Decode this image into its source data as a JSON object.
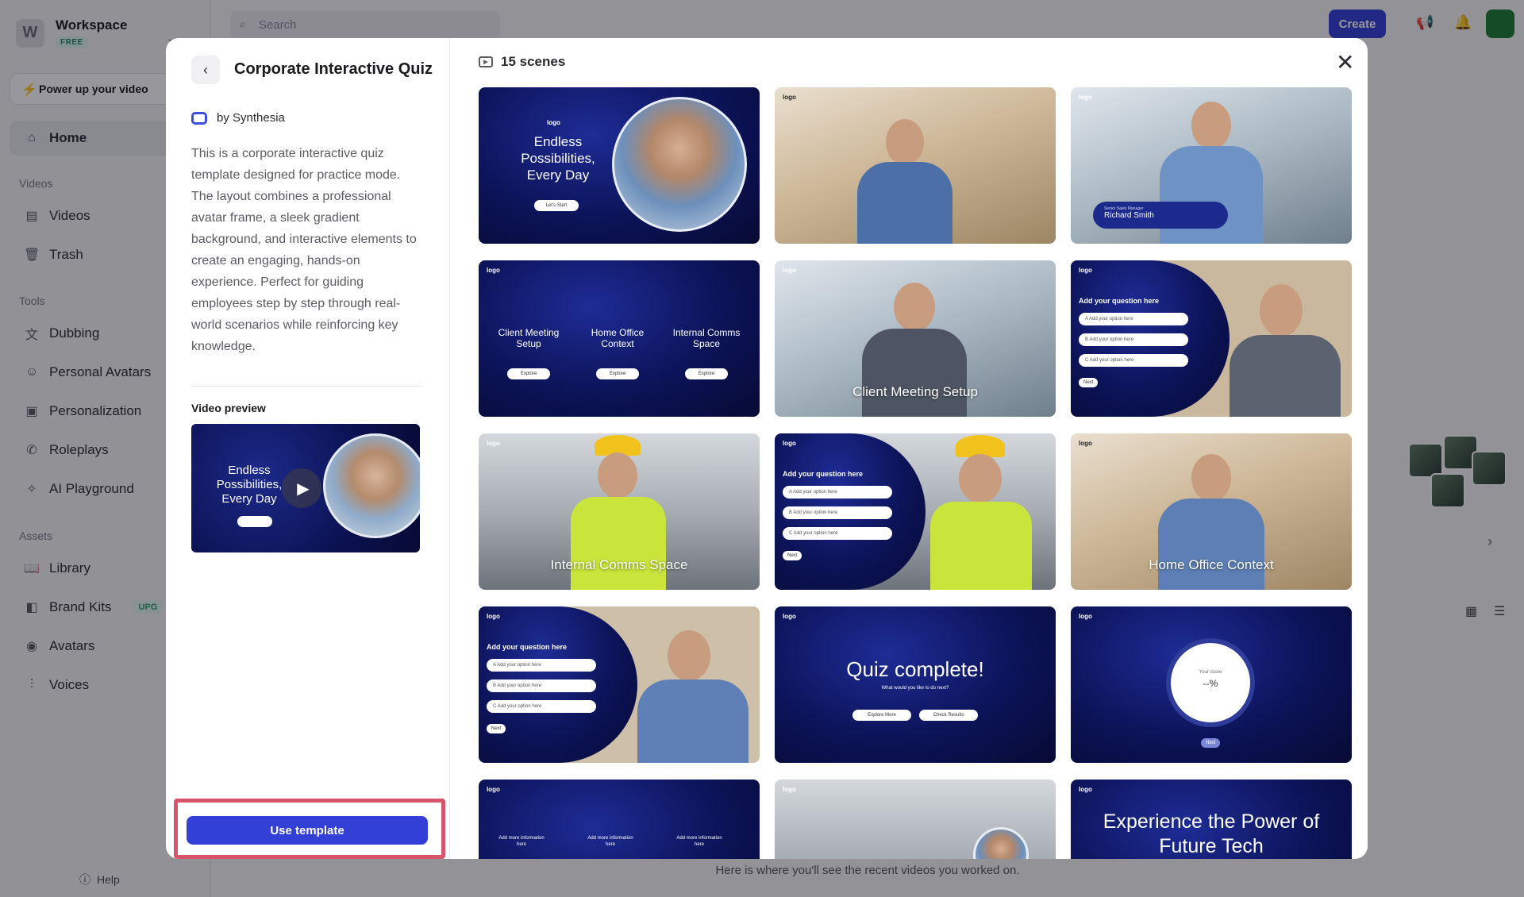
{
  "sidebar": {
    "workspace": {
      "logo_letter": "W",
      "name": "Workspace",
      "plan": "FREE"
    },
    "power_up": "Power up your video",
    "home": "Home",
    "sections": {
      "videos": "Videos",
      "tools": "Tools",
      "assets": "Assets"
    },
    "videos_items": [
      "Videos",
      "Trash"
    ],
    "tools_items": [
      "Dubbing",
      "Personal Avatars",
      "Personalization",
      "Roleplays",
      "AI Playground"
    ],
    "assets_items": [
      "Library",
      "Brand Kits",
      "Avatars",
      "Voices"
    ],
    "upgrade_badge": "UPG",
    "help": "Help"
  },
  "topbar": {
    "search_placeholder": "Search",
    "create": "Create"
  },
  "background": {
    "recent_message": "Here is where you'll see the recent videos you worked on."
  },
  "modal": {
    "title": "Corporate Interactive Quiz",
    "author": "by Synthesia",
    "description": "This is a corporate interactive quiz template designed for practice mode. The layout combines a professional avatar frame, a sleek gradient background, and interactive elements to create an engaging, hands-on experience. Perfect for guiding employees step by step through real-world scenarios while reinforcing key knowledge.",
    "video_preview_label": "Video preview",
    "preview_text": "Endless Possibilities, Every Day",
    "use_template": "Use template",
    "scenes_count": "15 scenes",
    "scenes": {
      "s1_text": "Endless Possibilities, Every Day",
      "s1_button": "Let's Start",
      "s3_role": "Senior Sales Manager",
      "s3_name": "Richard Smith",
      "s4_cols": [
        "Client Meeting Setup",
        "Home Office Context",
        "Internal Comms Space"
      ],
      "s4_button": "Explore",
      "s5_caption": "Client Meeting Setup",
      "question": "Add your question here",
      "options": [
        "Add your option here",
        "Add your option here",
        "Add your option here"
      ],
      "option_letters": [
        "A",
        "B",
        "C"
      ],
      "next": "Next",
      "s7_caption": "Internal Comms Space",
      "s9_caption": "Home Office Context",
      "s11_title": "Quiz complete!",
      "s11_sub": "What would you like to do next?",
      "s11_btns": [
        "Explore More",
        "Check Results"
      ],
      "s12_label": "Your score",
      "s12_value": "--%",
      "s13_cols": [
        "Add more information here",
        "Add more information here",
        "Add more information here"
      ],
      "s15_title": "Experience the Power of Future Tech",
      "logo": "logo"
    }
  }
}
